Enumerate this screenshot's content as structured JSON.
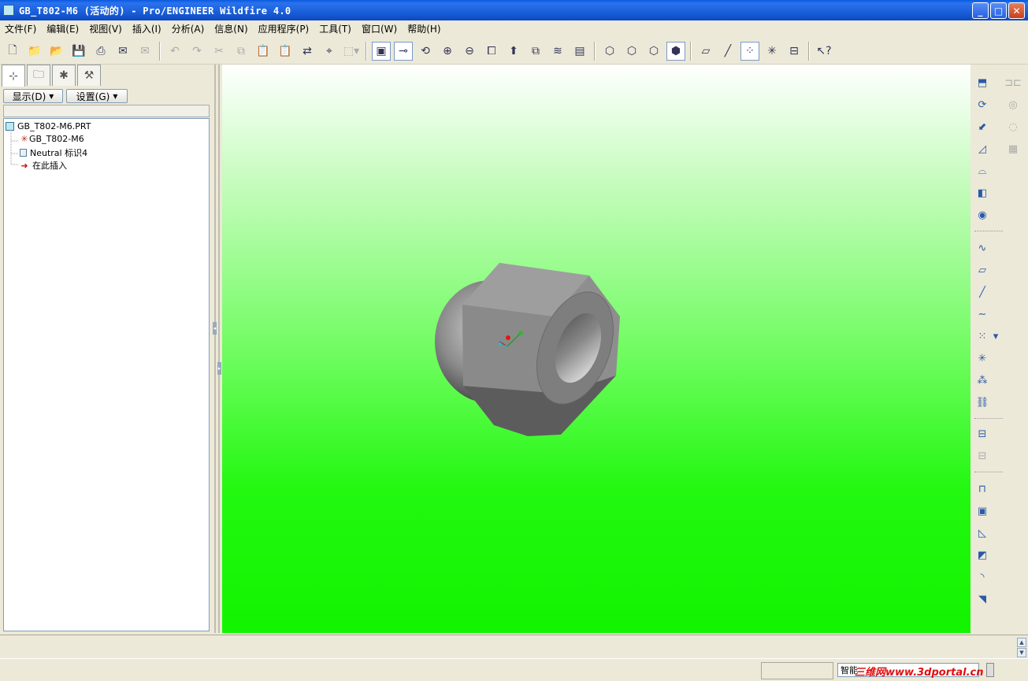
{
  "window": {
    "title": "GB_T802-M6 (活动的) - Pro/ENGINEER Wildfire 4.0"
  },
  "menu": [
    "文件(F)",
    "编辑(E)",
    "视图(V)",
    "插入(I)",
    "分析(A)",
    "信息(N)",
    "应用程序(P)",
    "工具(T)",
    "窗口(W)",
    "帮助(H)"
  ],
  "navigator": {
    "display_label": "显示(D)",
    "settings_label": "设置(G)",
    "tree": [
      {
        "label": "GB_T802-M6.PRT",
        "icon": "part-icon"
      },
      {
        "label": "GB_T802-M6",
        "icon": "csys-icon"
      },
      {
        "label": "Neutral 标识4",
        "icon": "feature-icon"
      },
      {
        "label": "在此插入",
        "icon": "insert-here-arrow-icon"
      }
    ]
  },
  "status": {
    "filter_prefix": "智能",
    "watermark": "三维网www.3dportal.cn"
  },
  "colors": {
    "viewport_top": "#ffffff",
    "viewport_bottom": "#12f400",
    "titlebar": "#0a5ae0",
    "watermark": "#e01010"
  }
}
